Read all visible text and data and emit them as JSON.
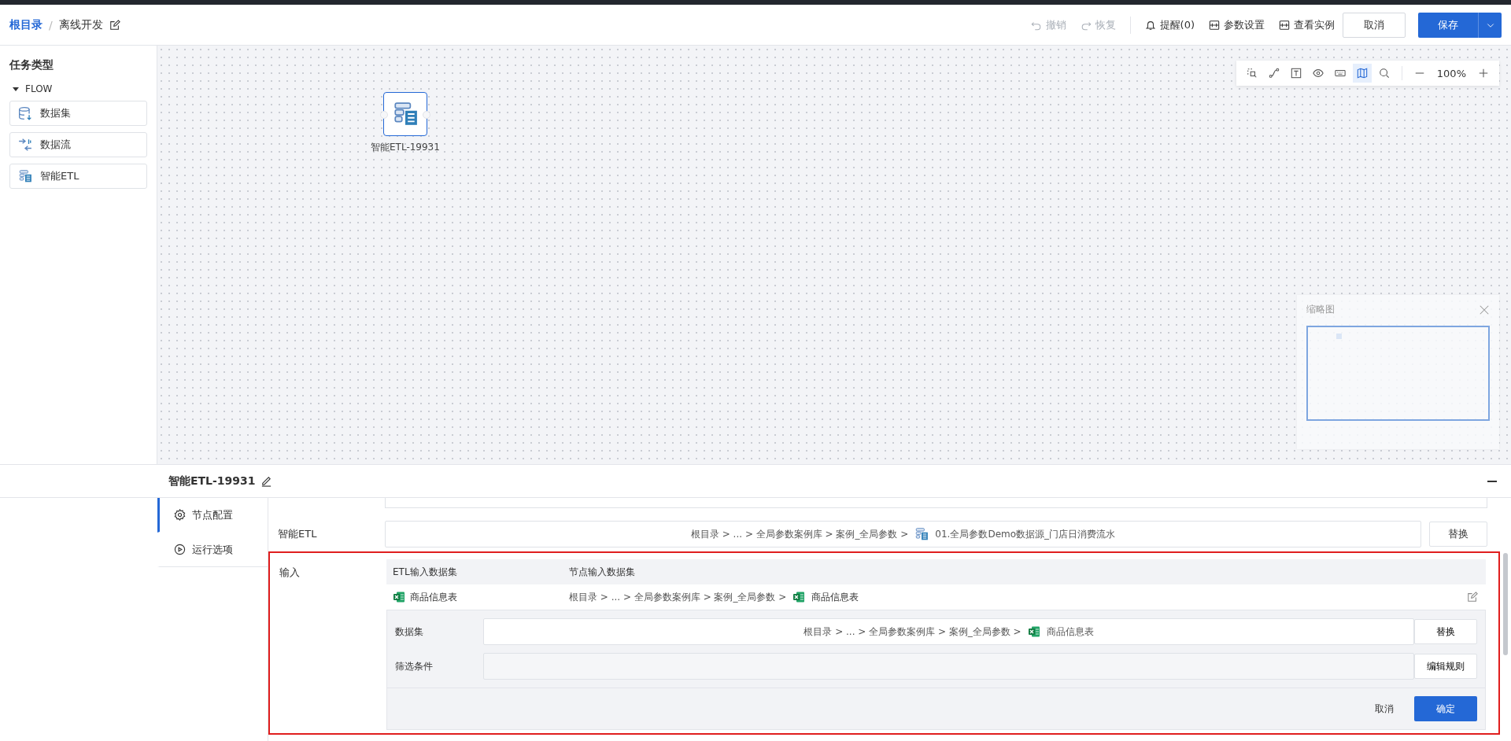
{
  "breadcrumb": {
    "items": [
      {
        "label": "根目录",
        "link": true
      },
      {
        "label": "离线开发",
        "link": false
      }
    ],
    "separator": "/"
  },
  "header_actions": [
    {
      "kind": "undo",
      "label": "撤销",
      "disabled": true
    },
    {
      "kind": "redo",
      "label": "恢复",
      "disabled": true
    },
    {
      "kind": "bell",
      "label": "提醒(0)",
      "disabled": false
    },
    {
      "kind": "params",
      "label": "参数设置",
      "disabled": false
    },
    {
      "kind": "instance",
      "label": "查看实例",
      "disabled": false
    }
  ],
  "cancel_button": "取消",
  "save_button": "保存",
  "sidebar": {
    "title": "任务类型",
    "group": {
      "label": "FLOW",
      "expanded": true,
      "items": [
        {
          "label": "数据集",
          "kind": "dataset"
        },
        {
          "label": "数据流",
          "kind": "dataflow"
        },
        {
          "label": "智能ETL",
          "kind": "etl"
        }
      ]
    }
  },
  "canvas": {
    "tools": [
      {
        "kind": "select-area",
        "selected": false
      },
      {
        "kind": "connect",
        "selected": false
      },
      {
        "kind": "text",
        "selected": false
      },
      {
        "kind": "eye",
        "selected": false
      },
      {
        "kind": "keyboard",
        "selected": false
      },
      {
        "kind": "map",
        "selected": true
      },
      {
        "kind": "search",
        "selected": false
      }
    ],
    "zoom": "100%",
    "nodes": [
      {
        "label": "智能ETL-19931",
        "kind": "etl",
        "selected": true
      }
    ],
    "minimap": {
      "title": "缩略图"
    }
  },
  "panel": {
    "title": "智能ETL-19931",
    "tabs": [
      {
        "label": "节点配置",
        "kind": "config",
        "selected": true
      },
      {
        "label": "运行选项",
        "kind": "run",
        "selected": false
      }
    ],
    "etl_field": {
      "label": "智能ETL",
      "path": "根目录 > ... > 全局参数案例库 > 案例_全局参数 >",
      "name": "01.全局参数Demo数据源_门店日消费流水",
      "button": "替换"
    },
    "input": {
      "label": "输入",
      "columns": [
        "ETL输入数据集",
        "节点输入数据集"
      ],
      "rows": [
        {
          "name": "商品信息表",
          "path": "根目录 > ... > 全局参数案例库 > 案例_全局参数 >",
          "target": "商品信息表",
          "expanded": true
        }
      ],
      "editor": {
        "dataset_label": "数据集",
        "dataset_path": "根目录 > ... > 全局参数案例库 > 案例_全局参数 >",
        "dataset_name": "商品信息表",
        "replace_button": "替换",
        "filter_label": "筛选条件",
        "filter_button": "编辑规则",
        "cancel": "取消",
        "confirm": "确定"
      }
    }
  }
}
